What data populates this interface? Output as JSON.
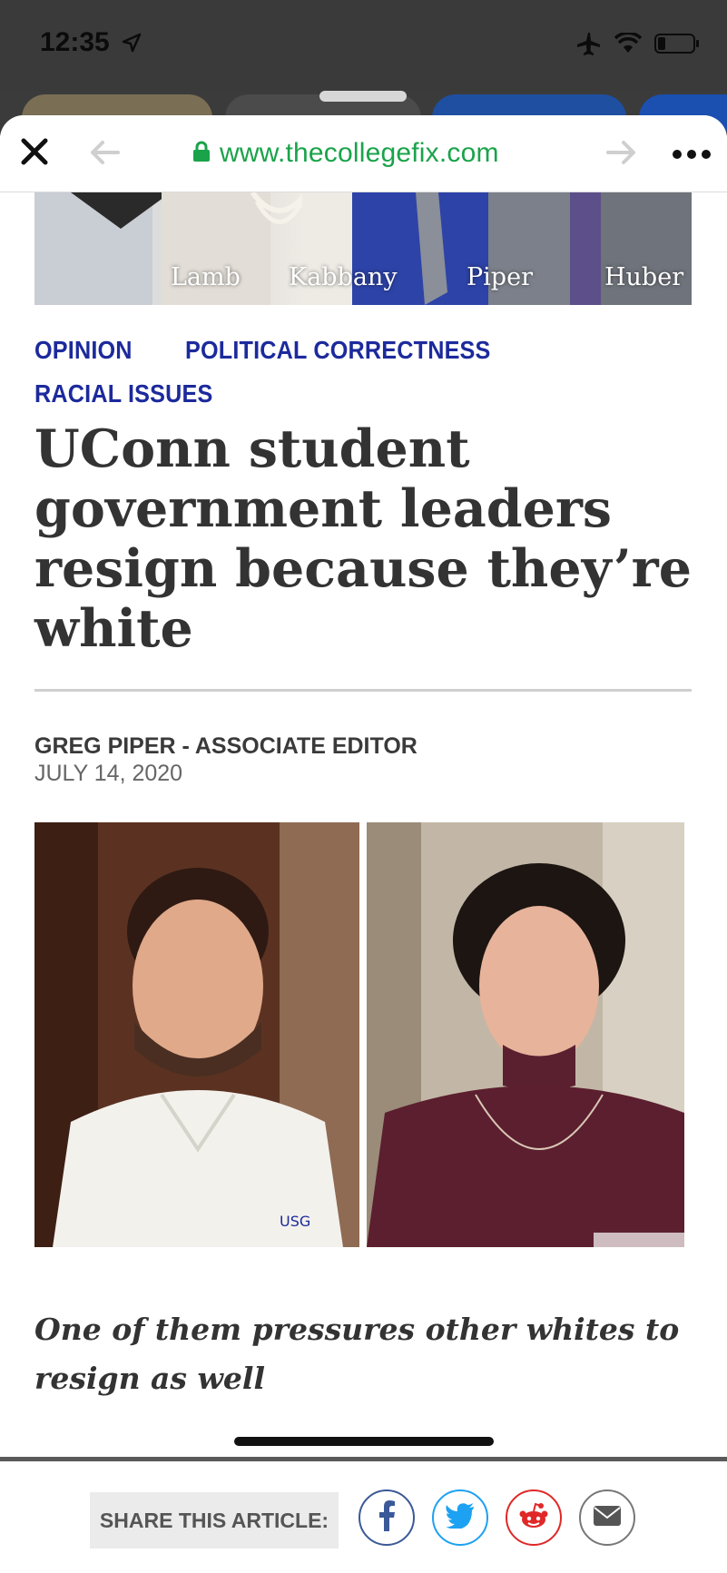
{
  "status_bar": {
    "time": "12:35"
  },
  "browser": {
    "url": "www.thecollegefix.com"
  },
  "hero_image": {
    "labels": [
      "Lamb",
      "Kabbany",
      "Piper",
      "Huber"
    ]
  },
  "article": {
    "tags": [
      "OPINION",
      "POLITICAL CORRECTNESS",
      "RACIAL ISSUES"
    ],
    "headline": "UConn student government leaders resign because they’re white",
    "byline": "GREG PIPER - ASSOCIATE EDITOR",
    "date": "JULY 14, 2020",
    "photo_badge": "USG",
    "subhead": "One of them pressures other whites to resign as well"
  },
  "share": {
    "label": "SHARE THIS ARTICLE:"
  },
  "colors": {
    "url_green": "#1aa34a",
    "tag_blue": "#1c2a9c",
    "facebook": "#3b5998",
    "twitter": "#1da1f2",
    "reddit": "#e02828",
    "email": "#555555"
  }
}
